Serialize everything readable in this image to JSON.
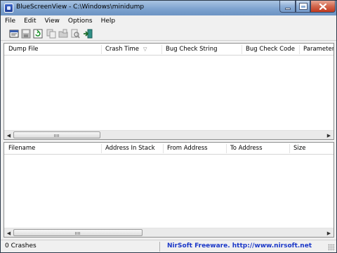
{
  "window": {
    "title": "BlueScreenView  -  C:\\Windows\\minidump"
  },
  "menu": [
    "File",
    "Edit",
    "View",
    "Options",
    "Help"
  ],
  "toolbar": [
    {
      "name": "properties-icon"
    },
    {
      "name": "save-icon"
    },
    {
      "name": "refresh-icon"
    },
    {
      "name": "copy-icon"
    },
    {
      "name": "open-folder-icon"
    },
    {
      "name": "find-icon"
    },
    {
      "name": "exit-icon"
    }
  ],
  "top_table": {
    "columns": [
      "Dump File",
      "Crash Time",
      "Bug Check String",
      "Bug Check Code",
      "Parameter"
    ],
    "sort_indicator": "▽",
    "rows": []
  },
  "bottom_table": {
    "columns": [
      "Filename",
      "Address In Stack",
      "From Address",
      "To Address",
      "Size"
    ],
    "rows": []
  },
  "scroll_arrows": {
    "left": "◀",
    "right": "▶"
  },
  "status": {
    "count": "0 Crashes",
    "link": "NirSoft Freeware.  http://www.nirsoft.net"
  },
  "colors": {
    "link": "#1a37c8",
    "close_button": "#c0391e",
    "titlebar": "#7ea3cf"
  }
}
